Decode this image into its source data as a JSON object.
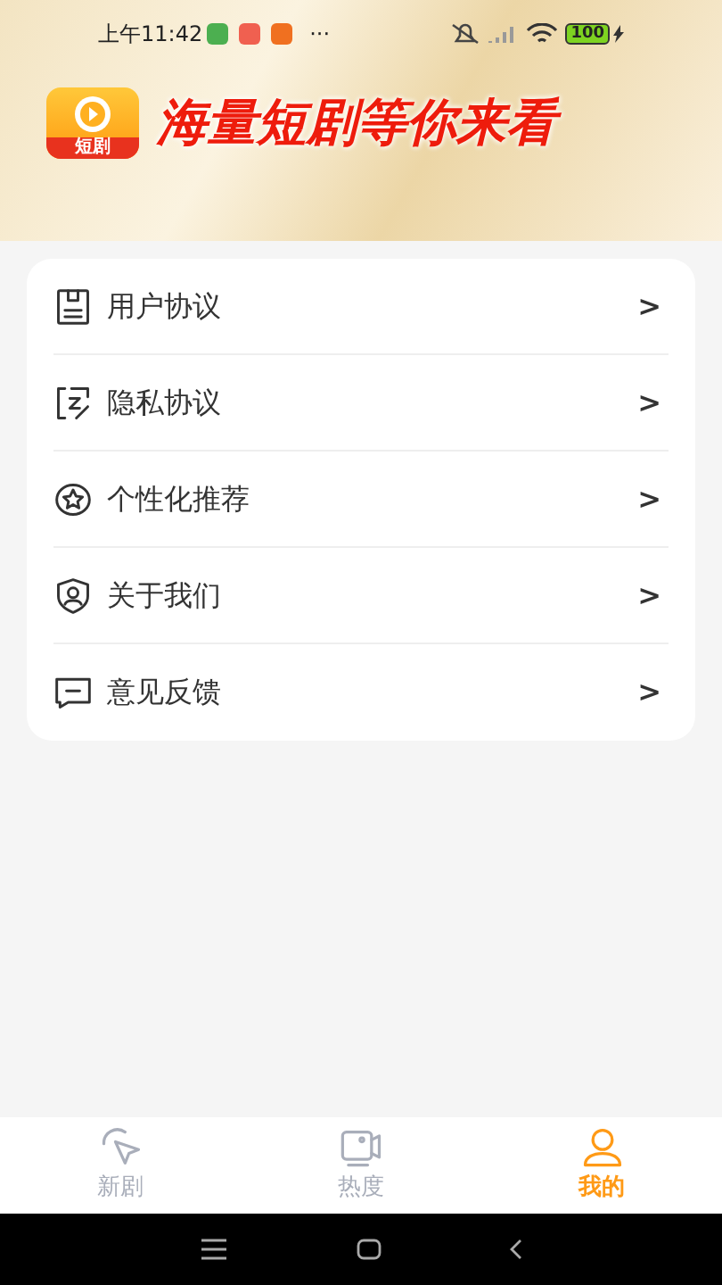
{
  "status_bar": {
    "time": "上午11:42",
    "more": "···",
    "battery": "100"
  },
  "banner": {
    "logo_text": "短剧",
    "slogan": "海量短剧等你来看"
  },
  "menu": [
    {
      "kind": "document",
      "label": "用户协议",
      "arrow": ">"
    },
    {
      "kind": "edit",
      "label": "隐私协议",
      "arrow": ">"
    },
    {
      "kind": "star",
      "label": "个性化推荐",
      "arrow": ">"
    },
    {
      "kind": "shield",
      "label": "关于我们",
      "arrow": ">"
    },
    {
      "kind": "message",
      "label": "意见反馈",
      "arrow": ">"
    }
  ],
  "tabs": [
    {
      "kind": "new",
      "label": "新剧",
      "selected": false
    },
    {
      "kind": "hot",
      "label": "热度",
      "selected": false
    },
    {
      "kind": "mine",
      "label": "我的",
      "selected": true
    }
  ]
}
